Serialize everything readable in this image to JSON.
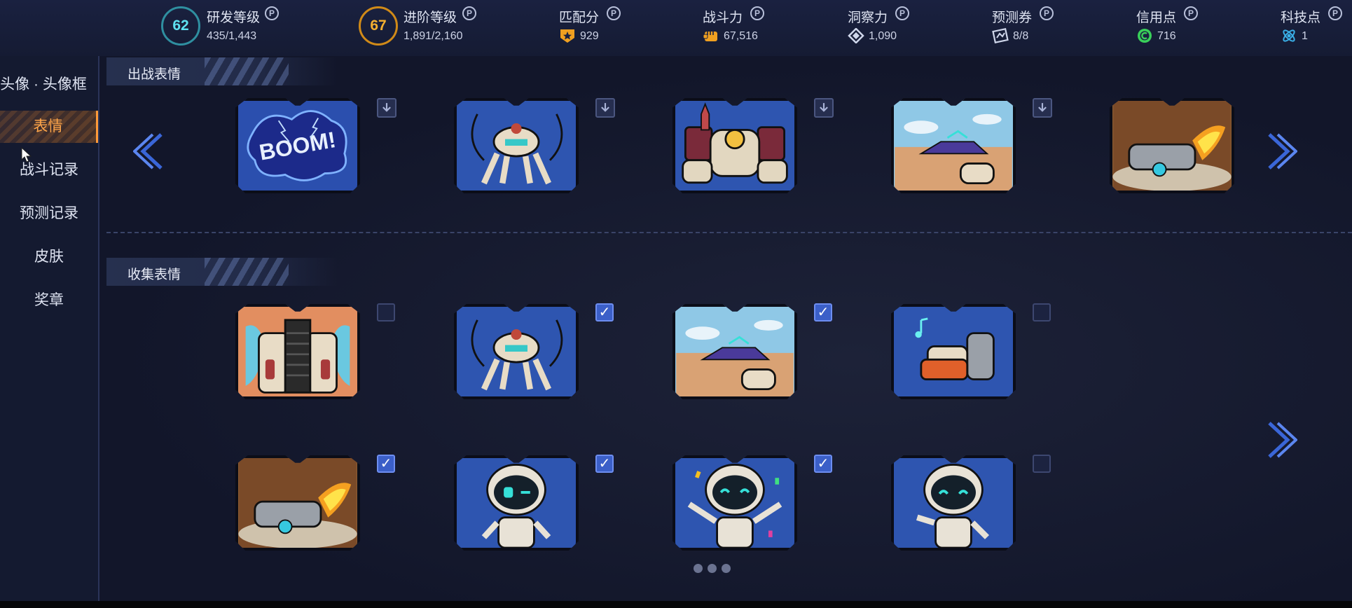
{
  "stats": [
    {
      "level": "62",
      "name": "研发等级",
      "value": "435/1,443",
      "icon": "research-ring",
      "color": "#4ad0e0"
    },
    {
      "level": "67",
      "name": "进阶等级",
      "value": "1,891/2,160",
      "icon": "advance-ring",
      "color": "#f0a020"
    },
    {
      "name": "匹配分",
      "value": "929",
      "icon": "star-shield-icon",
      "color": "#f0a020"
    },
    {
      "name": "战斗力",
      "value": "67,516",
      "icon": "fist-icon",
      "color": "#f0a020"
    },
    {
      "name": "洞察力",
      "value": "1,090",
      "icon": "insight-icon",
      "color": "#cfd6ea"
    },
    {
      "name": "预测券",
      "value": "8/8",
      "icon": "ticket-icon",
      "color": "#cfd6ea"
    },
    {
      "name": "信用点",
      "value": "716",
      "icon": "credit-icon",
      "color": "#39d05a"
    },
    {
      "name": "科技点",
      "value": "1",
      "icon": "atom-icon",
      "color": "#3ab0e8"
    }
  ],
  "help_glyph": "P",
  "sidebar": {
    "items": [
      {
        "label": "头像 · 头像框",
        "active": false
      },
      {
        "label": "表情",
        "active": true
      },
      {
        "label": "战斗记录",
        "active": false
      },
      {
        "label": "预测记录",
        "active": false
      },
      {
        "label": "皮肤",
        "active": false
      },
      {
        "label": "奖章",
        "active": false
      }
    ]
  },
  "equipped": {
    "title": "出战表情",
    "emotes": [
      "boom",
      "claw-robot",
      "heavy-mech",
      "desert-tank",
      "flame-cannon"
    ]
  },
  "collection": {
    "title": "收集表情",
    "emotes": [
      {
        "art": "twin-missile",
        "checked": false
      },
      {
        "art": "claw-robot",
        "checked": true
      },
      {
        "art": "desert-tank",
        "checked": true
      },
      {
        "art": "music-mech",
        "checked": false
      },
      {
        "art": "flame-cannon",
        "checked": true
      },
      {
        "art": "robot-wink",
        "checked": true
      },
      {
        "art": "robot-party",
        "checked": true
      },
      {
        "art": "robot-wave",
        "checked": false
      }
    ]
  },
  "pagination": {
    "pages": 3
  },
  "colors": {
    "accent": "#ffa64a",
    "check": "#3b5fc8",
    "card_blue": "#2e55b0"
  }
}
